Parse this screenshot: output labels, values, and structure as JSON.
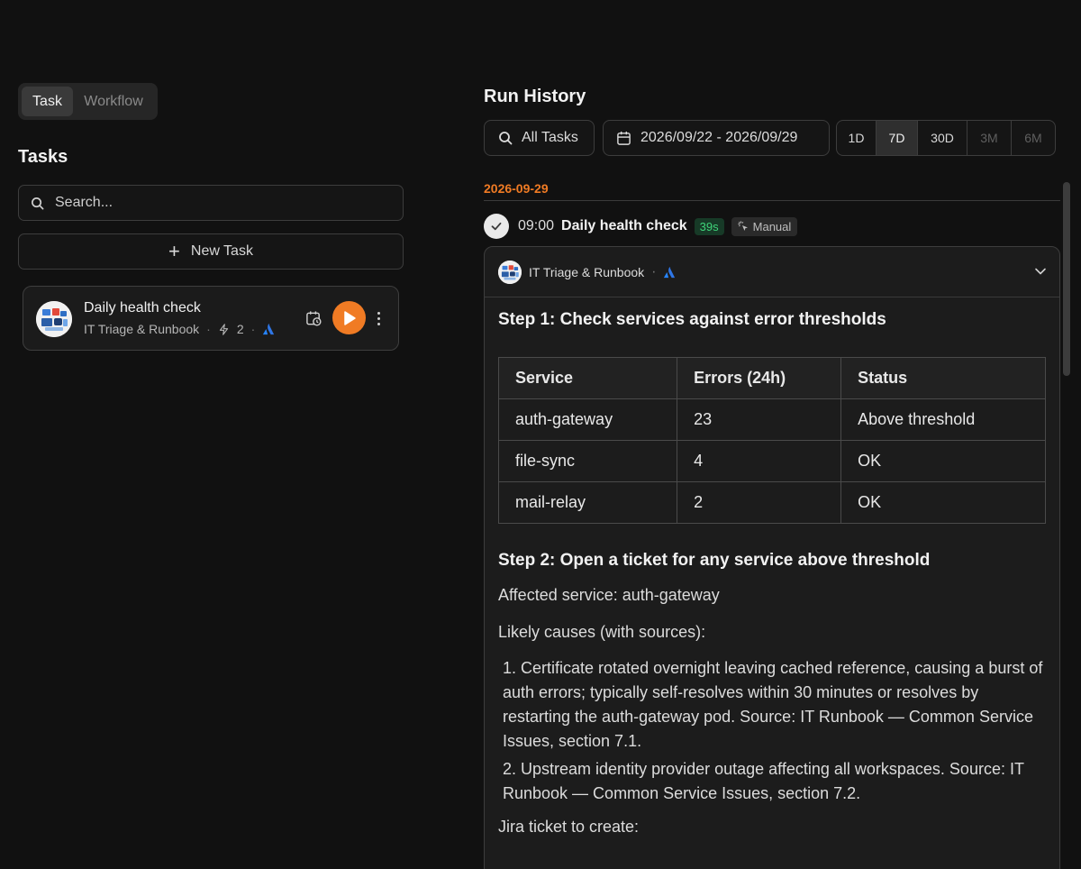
{
  "mode_toggle": {
    "task_label": "Task",
    "workflow_label": "Workflow"
  },
  "tasks_panel": {
    "title": "Tasks",
    "search_placeholder": "Search...",
    "new_task_label": "New Task",
    "items": [
      {
        "name": "Daily health check",
        "agent": "IT Triage & Runbook",
        "tool_count": "2",
        "integration_icon": "atlassian-icon"
      }
    ]
  },
  "run_history": {
    "title": "Run History",
    "task_filter": "All Tasks",
    "date_range": "2026/09/22 - 2026/09/29",
    "ranges": [
      "1D",
      "7D",
      "30D",
      "3M",
      "6M"
    ],
    "active_range": "7D",
    "groups": [
      {
        "date": "2026-09-29",
        "runs": [
          {
            "time": "09:00",
            "name": "Daily health check",
            "duration": "39s",
            "trigger": "Manual",
            "agent": "IT Triage & Runbook",
            "output": {
              "step1_heading": "Step 1: Check services against error thresholds",
              "table": {
                "headers": [
                  "Service",
                  "Errors (24h)",
                  "Status"
                ],
                "rows": [
                  [
                    "auth-gateway",
                    "23",
                    "Above threshold"
                  ],
                  [
                    "file-sync",
                    "4",
                    "OK"
                  ],
                  [
                    "mail-relay",
                    "2",
                    "OK"
                  ]
                ]
              },
              "step2_heading": "Step 2: Open a ticket for any service above threshold",
              "affected": "Affected service: auth-gateway",
              "causes_intro": "Likely causes (with sources):",
              "causes": [
                "1. Certificate rotated overnight leaving cached reference, causing a burst of auth errors; typically self-resolves within 30 minutes or resolves by restarting the auth-gateway pod. Source: IT Runbook — Common Service Issues, section 7.1.",
                "2. Upstream identity provider outage affecting all workspaces. Source: IT Runbook — Common Service Issues, section 7.2."
              ],
              "jira_intro": "Jira ticket to create:"
            }
          }
        ]
      }
    ]
  },
  "colors": {
    "accent": "#f07b24",
    "success": "#3fd47a",
    "background": "#111111"
  }
}
